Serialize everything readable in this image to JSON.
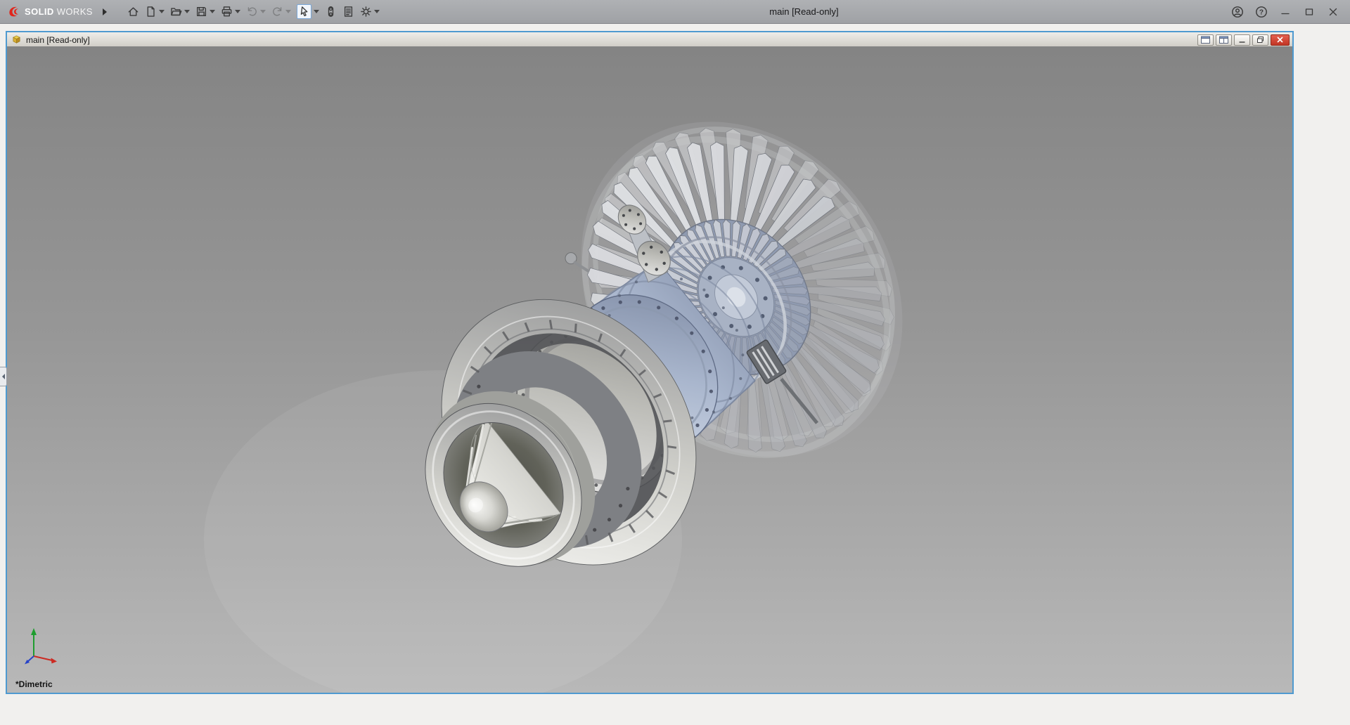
{
  "titlebar": {
    "brand": {
      "bold": "SOLID",
      "light": "WORKS"
    },
    "document_title": "main [Read-only]",
    "toolbar_icons": [
      "home",
      "new-document",
      "open",
      "save",
      "print",
      "undo",
      "redo",
      "select",
      "rebuild",
      "file-properties",
      "options"
    ],
    "window_controls": [
      "account",
      "help",
      "minimize",
      "maximize",
      "close"
    ]
  },
  "document_window": {
    "title": "main [Read-only]",
    "window_controls": [
      "tile-window",
      "tile-window-split",
      "minimize",
      "restore",
      "close"
    ]
  },
  "viewport": {
    "orientation_label": "*Dimetric",
    "triad_axes": [
      {
        "axis": "x",
        "color": "#cc2a22"
      },
      {
        "axis": "y",
        "color": "#1f9d2f"
      },
      {
        "axis": "z",
        "color": "#2743c8"
      }
    ],
    "background_top": "#848484",
    "background_bottom": "#b8b8b8"
  },
  "colors": {
    "brand_red": "#e1251b",
    "close_button_red": "#c23524",
    "titlebar_gray": "#a6a8ab",
    "model_metal": "#d6d7d4",
    "model_blue": "#a9b6cd",
    "window_border_blue": "#4f9ad0"
  }
}
